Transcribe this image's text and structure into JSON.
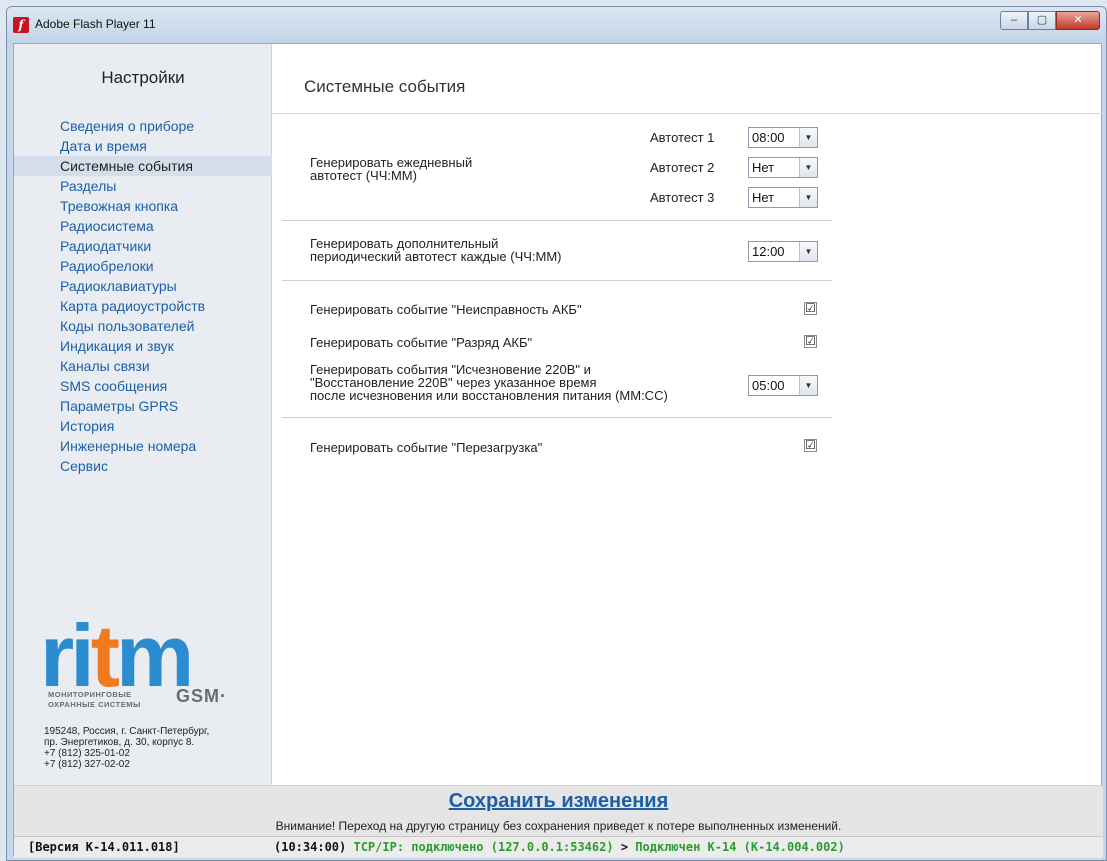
{
  "window": {
    "title": "Adobe Flash Player 11",
    "app_icon": "flash-icon",
    "controls": {
      "minimize": "–",
      "maximize": "▢",
      "close": "✕"
    }
  },
  "sidebar": {
    "title": "Настройки",
    "items": [
      {
        "label": "Сведения о приборе",
        "active": false
      },
      {
        "label": "Дата и время",
        "active": false
      },
      {
        "label": "Системные события",
        "active": true
      },
      {
        "label": "Разделы",
        "active": false
      },
      {
        "label": "Тревожная кнопка",
        "active": false
      },
      {
        "label": "Радиосистема",
        "active": false
      },
      {
        "label": "Радиодатчики",
        "active": false
      },
      {
        "label": "Радиобрелоки",
        "active": false
      },
      {
        "label": "Радиоклавиатуры",
        "active": false
      },
      {
        "label": "Карта радиоустройств",
        "active": false
      },
      {
        "label": "Коды пользователей",
        "active": false
      },
      {
        "label": "Индикация и звук",
        "active": false
      },
      {
        "label": "Каналы связи",
        "active": false
      },
      {
        "label": "SMS сообщения",
        "active": false
      },
      {
        "label": "Параметры GPRS",
        "active": false
      },
      {
        "label": "История",
        "active": false
      },
      {
        "label": "Инженерные номера",
        "active": false
      },
      {
        "label": "Сервис",
        "active": false
      }
    ],
    "logo": {
      "word": "ritm",
      "sub_line1": "МОНИТОРИНГОВЫЕ",
      "sub_line2": "ОХРАННЫЕ СИСТЕМЫ",
      "gsm": "GSM·"
    },
    "address": [
      "195248, Россия, г. Санкт-Петербург,",
      "пр. Энергетиков, д. 30, корпус 8.",
      "+7 (812) 325-01-02",
      "+7 (812) 327-02-02"
    ]
  },
  "main": {
    "title": "Системные события",
    "daily_autotest": {
      "label_line1": "Генерировать ежедневный",
      "label_line2": "автотест (ЧЧ:ММ)",
      "tests": [
        {
          "label": "Автотест 1",
          "value": "08:00"
        },
        {
          "label": "Автотест 2",
          "value": "Нет"
        },
        {
          "label": "Автотест 3",
          "value": "Нет"
        }
      ]
    },
    "periodic_autotest": {
      "label_line1": "Генерировать дополнительный",
      "label_line2": "периодический автотест каждые (ЧЧ:ММ)",
      "value": "12:00"
    },
    "battery_fault": {
      "label": "Генерировать событие \"Неисправность АКБ\"",
      "checked": true
    },
    "battery_low": {
      "label": "Генерировать событие \"Разряд АКБ\"",
      "checked": true
    },
    "power_loss": {
      "label_line1": "Генерировать события \"Исчезновение 220В\" и",
      "label_line2": "\"Восстановление 220В\" через указанное время",
      "label_line3": "после исчезновения или восстановления питания (ММ:СС)",
      "value": "05:00"
    },
    "reboot": {
      "label": "Генерировать событие \"Перезагрузка\"",
      "checked": true
    },
    "check_mark": "☑",
    "dropdown_arrow": "▼"
  },
  "footer": {
    "save_label": "Сохранить изменения",
    "warning": "Внимание! Переход на другую страницу без сохранения приведет к потере выполненных изменений.",
    "version": "[Версия К-14.011.018]",
    "time": "(10:34:00)",
    "tcp": "TCP/IP: подключено (127.0.0.1:53462)",
    "arrow": ">",
    "connected": "Подключен К-14 (К-14.004.002)",
    "status_green": "#2e9b2e"
  },
  "colors": {
    "link": "#1d5fa6",
    "accent_orange": "#ef7a1f",
    "accent_blue": "#2b8ccf"
  }
}
